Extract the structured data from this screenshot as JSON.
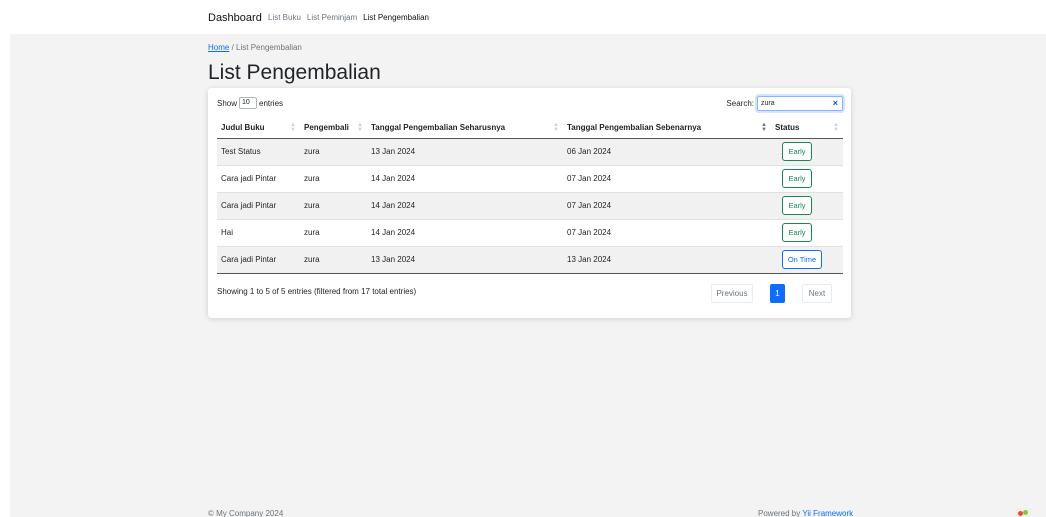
{
  "nav": {
    "brand": "Dashboard",
    "links": [
      "List Buku",
      "List Peminjam",
      "List Pengembalian"
    ]
  },
  "breadcrumb": {
    "home": "Home",
    "separator": "/",
    "current": "List Pengembalian"
  },
  "page_title": "List Pengembalian",
  "table_controls": {
    "show_label": "Show",
    "entries_value": "10",
    "entries_label": "entries",
    "search_label": "Search:",
    "search_value": "zura",
    "clear_symbol": "×"
  },
  "table": {
    "headers": [
      "Judul Buku",
      "Pengembali",
      "Tanggal Pengembalian Seharusnya",
      "Tanggal Pengembalian Sebenarnya",
      "Status"
    ],
    "rows": [
      [
        "Test Status",
        "zura",
        "13 Jan 2024",
        "06 Jan 2024",
        "Early"
      ],
      [
        "Cara jadi Pintar",
        "zura",
        "14 Jan 2024",
        "07 Jan 2024",
        "Early"
      ],
      [
        "Cara jadi Pintar",
        "zura",
        "14 Jan 2024",
        "07 Jan 2024",
        "Early"
      ],
      [
        "Hai",
        "zura",
        "14 Jan 2024",
        "07 Jan 2024",
        "Early"
      ],
      [
        "Cara jadi Pintar",
        "zura",
        "13 Jan 2024",
        "13 Jan 2024",
        "On Time"
      ]
    ],
    "sorted_column": "Status"
  },
  "pagination": {
    "info": "Showing 1 to 5 of 5 entries (filtered from 17 total entries)",
    "previous": "Previous",
    "current_page": "1",
    "next": "Next"
  },
  "footer": {
    "copyright": "© My Company 2024",
    "powered_prefix": "Powered by",
    "powered_link": "Yii Framework"
  },
  "colors": {
    "primary": "#0d6efd",
    "success": "#198754"
  }
}
